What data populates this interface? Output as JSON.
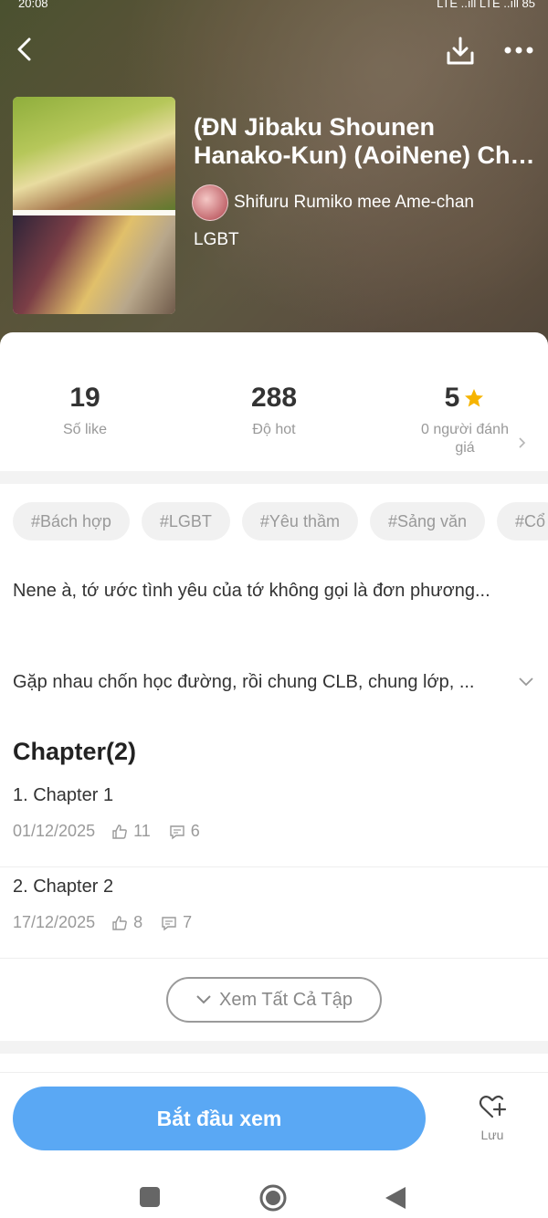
{
  "status": {
    "time": "20:08",
    "right": "LTE ..ıll LTE ..ıll 85"
  },
  "header": {
    "back_icon": "chevron-left-icon",
    "download_icon": "download-icon",
    "more_icon": "more-dots-icon"
  },
  "story": {
    "title_line1": "(ĐN Jibaku Shounen",
    "title_line2": "Hanako-Kun) (AoiNene) Chapter",
    "author": "Shifuru Rumiko mee Ame-chan",
    "genre": "LGBT"
  },
  "stats": {
    "likes": "19",
    "likes_label": "Số like",
    "hot": "288",
    "hot_label": "Độ hot",
    "rating": "5",
    "rating_label": "0 người đánh giá"
  },
  "tags": [
    "#Bách hợp",
    "#LGBT",
    "#Yêu thầm",
    "#Sảng văn",
    "#Cổ"
  ],
  "description": {
    "para1": "Nene à, tớ ước tình yêu của tớ không gọi là đơn phương...",
    "para2": "Gặp nhau chốn học đường, rồi chung CLB, chung lớp, ..."
  },
  "chapters_heading": "Chapter(2)",
  "chapters": [
    {
      "name": "1. Chapter 1",
      "date": "01/12/2025",
      "likes": "11",
      "comments": "6"
    },
    {
      "name": "2. Chapter 2",
      "date": "17/12/2025",
      "likes": "8",
      "comments": "7"
    }
  ],
  "view_all_label": "Xem Tất Cả Tập",
  "start_label": "Bắt đầu xem",
  "save_label": "Lưu",
  "colors": {
    "accent": "#5aa8f4",
    "star": "#f6b400",
    "tag_bg": "#f1f1f1"
  }
}
